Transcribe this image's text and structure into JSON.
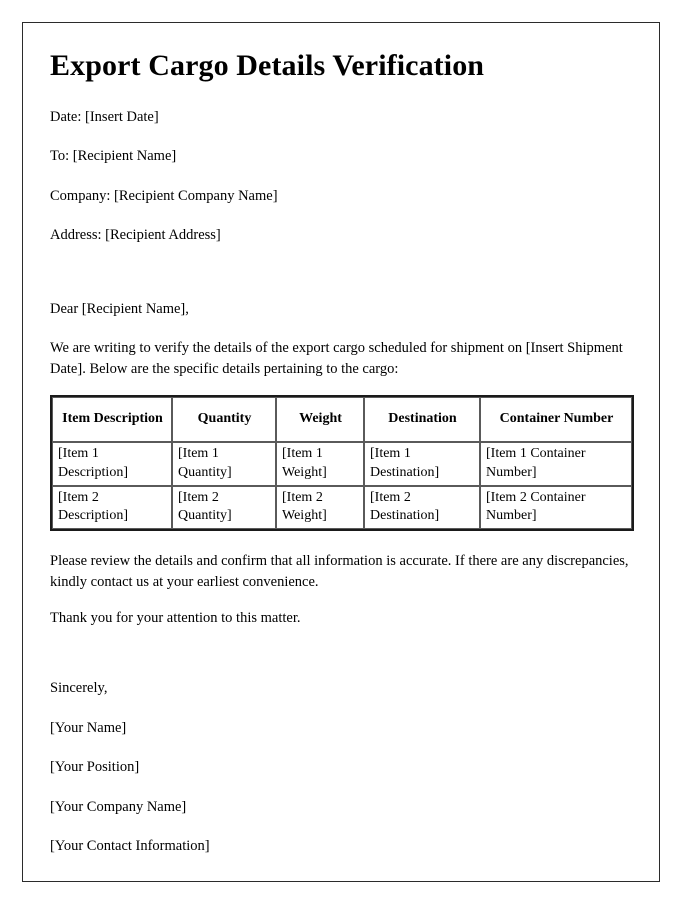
{
  "document": {
    "title": "Export Cargo Details Verification",
    "header_lines": [
      "Date: [Insert Date]",
      "To: [Recipient Name]",
      "Company: [Recipient Company Name]",
      "Address: [Recipient Address]"
    ],
    "salutation": "Dear [Recipient Name],",
    "intro_paragraph": "We are writing to verify the details of the export cargo scheduled for shipment on [Insert Shipment Date]. Below are the specific details pertaining to the cargo:",
    "closing_paragraphs": [
      "Please review the details and confirm that all information is accurate. If there are any discrepancies, kindly contact us at your earliest convenience.",
      "Thank you for your attention to this matter."
    ],
    "signature": {
      "closing": "Sincerely,",
      "lines": [
        "[Your Name]",
        "[Your Position]",
        "[Your Company Name]",
        "[Your Contact Information]"
      ]
    },
    "cargo_table": {
      "columns": [
        "Item Description",
        "Quantity",
        "Weight",
        "Destination",
        "Container Number"
      ],
      "rows": [
        [
          "[Item 1 Description]",
          "[Item 1 Quantity]",
          "[Item 1 Weight]",
          "[Item 1 Destination]",
          "[Item 1 Container Number]"
        ],
        [
          "[Item 2 Description]",
          "[Item 2 Quantity]",
          "[Item 2 Weight]",
          "[Item 2 Destination]",
          "[Item 2 Container Number]"
        ]
      ]
    },
    "colors": {
      "text": "#000000",
      "page_border": "#2b2b2b",
      "table_outer_border": "#1a1a1a",
      "table_cell_border": "#5a5a5a",
      "background": "#ffffff"
    }
  }
}
